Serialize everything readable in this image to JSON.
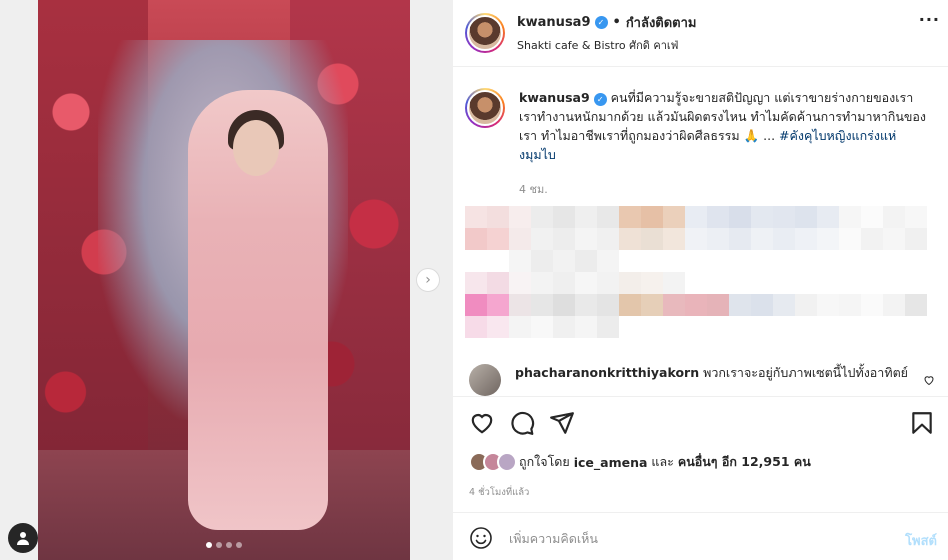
{
  "header": {
    "username": "kwanusa9",
    "follow_status": "กำลังติดตาม",
    "location": "Shakti cafe & Bistro ศักดิ คาเฟ่",
    "more_icon": "more-horizontal-icon"
  },
  "caption": {
    "username": "kwanusa9",
    "text": "คนที่มีความรู้จะขายสติปัญญา แต่เราขายร่างกายของเรา เราทำงานหนักมากด้วย แล้วมันผิดตรงไหน ทำไมคัดค้านการทำมาหากินของเรา ทำไมอาชีพเราที่ถูกมองว่าผิดศีลธรรม 🙏 ... ",
    "hashtag": "#คังคุไบหญิงแกร่งแห่งมุมไบ",
    "time_ago": "4 ชม."
  },
  "comment": {
    "username": "phacharanonkritthiyakorn",
    "text": "พวกเราจะอยู่กับภาพเซตนี้ไปทั้งอาทิตย์"
  },
  "likes": {
    "prefix": "ถูกใจโดย",
    "user": "ice_amena",
    "and": "และ",
    "others": "คนอื่นๆ อีก 12,951 คน"
  },
  "post_time": "4 ชั่วโมงที่แล้ว",
  "add_comment": {
    "placeholder": "เพิ่มความคิดเห็น",
    "post_label": "โพสต์"
  },
  "carousel": {
    "total_slides": 4,
    "active_slide": 1,
    "next_icon": "chevron-right-icon"
  },
  "colors": {
    "link": "#00376b",
    "verified": "#3897f0",
    "post_button_disabled": "#b2dffc",
    "muted_text": "#8e8e8e"
  }
}
